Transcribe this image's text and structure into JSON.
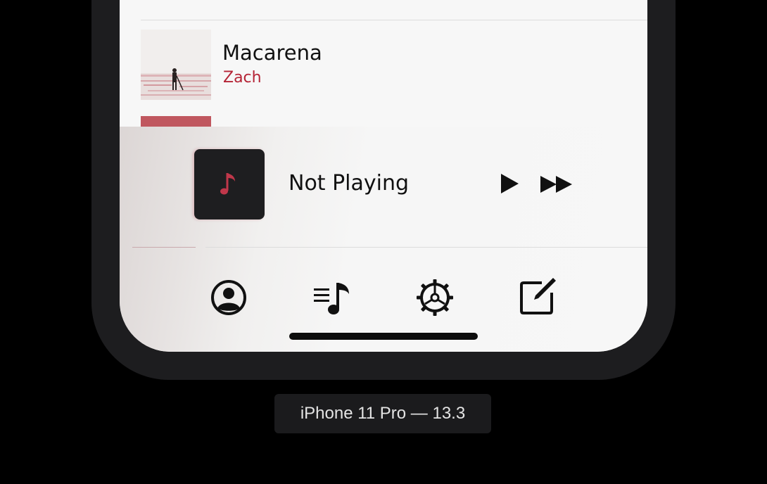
{
  "songs": [
    {
      "title": "",
      "artist": ""
    },
    {
      "title": "Macarena",
      "artist": "Zach"
    }
  ],
  "now_playing": {
    "title": "Not Playing",
    "art_icon": "music-note-icon"
  },
  "controls": [
    {
      "icon": "play-icon"
    },
    {
      "icon": "fast-forward-icon"
    }
  ],
  "tabs": [
    {
      "icon": "person-circle-icon"
    },
    {
      "icon": "music-list-icon"
    },
    {
      "icon": "gear-icon"
    },
    {
      "icon": "compose-icon"
    }
  ],
  "device_label": "iPhone 11 Pro — 13.3",
  "colors": {
    "accent": "#b52436",
    "background": "#f7f7f7",
    "device_frame": "#1d1d1f"
  }
}
